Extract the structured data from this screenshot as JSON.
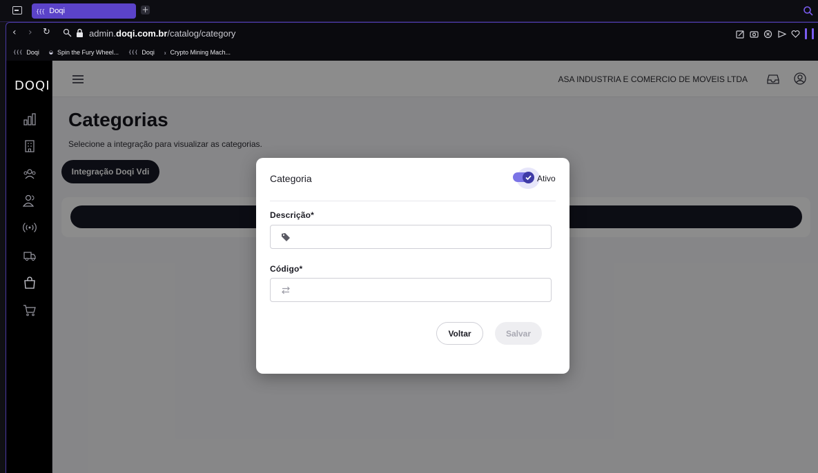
{
  "browser": {
    "tab_title": "Doqi",
    "tab_favicon": "{{{",
    "new_tab": "+",
    "url_prefix": "admin.",
    "url_domain": "doqi.com.br",
    "url_path": "/catalog/category",
    "bookmarks": [
      {
        "icon": "{{{",
        "label": "Doqi"
      },
      {
        "icon": "◒",
        "label": "Spin the Fury Wheel..."
      },
      {
        "icon": "{{{",
        "label": "Doqi"
      },
      {
        "icon": "ᵪ",
        "label": "Crypto Mining Mach..."
      }
    ]
  },
  "sidebar": {
    "logo": "DOQI",
    "icons": [
      "bar-chart-icon",
      "building-icon",
      "users-group-icon",
      "users-icon",
      "broadcast-icon",
      "truck-icon",
      "shopping-bag-icon",
      "cart-icon"
    ]
  },
  "header": {
    "company": "ASA INDUSTRIA E COMERCIO DE MOVEIS LTDA"
  },
  "page": {
    "title": "Categorias",
    "subtitle": "Selecione a integração para visualizar as categorias.",
    "integration_button": "Integração Doqi Vdi"
  },
  "modal": {
    "title": "Categoria",
    "toggle_label": "Ativo",
    "toggle_on": true,
    "description_label": "Descrição*",
    "description_value": "",
    "code_label": "Código*",
    "code_value": "",
    "back_button": "Voltar",
    "save_button": "Salvar"
  },
  "colors": {
    "accent": "#5b43c9",
    "toggle": "#7b74e6",
    "dark": "#161925"
  }
}
